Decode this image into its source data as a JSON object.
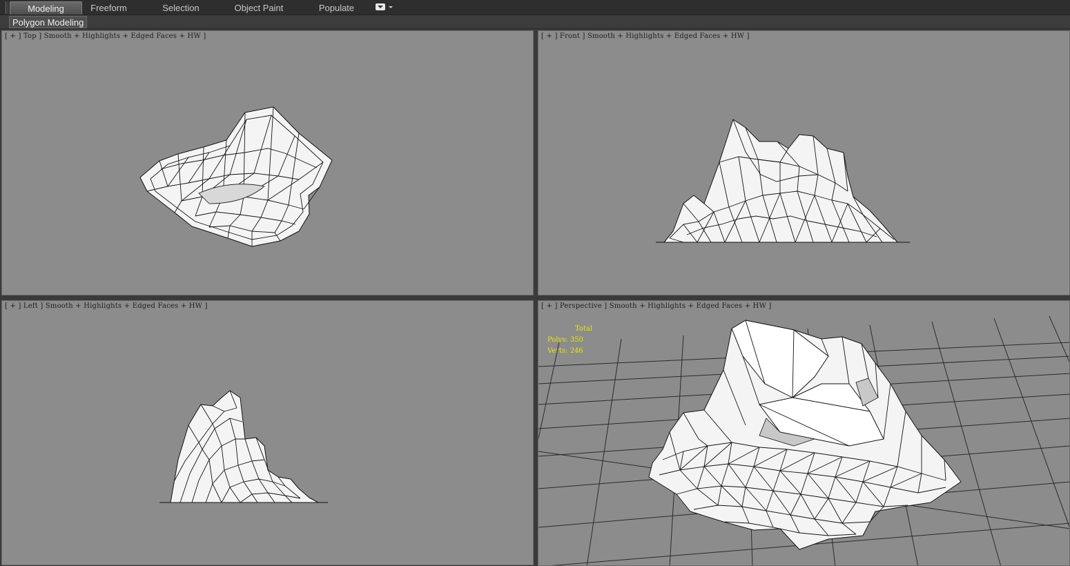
{
  "tabs": [
    {
      "label": "Modeling",
      "active": true
    },
    {
      "label": "Freeform",
      "active": false
    },
    {
      "label": "Selection",
      "active": false
    },
    {
      "label": "Object Paint",
      "active": false
    },
    {
      "label": "Populate",
      "active": false
    }
  ],
  "subtab": "Polygon Modeling",
  "viewports": {
    "top": "[ + ] Top ] Smooth + Highlights + Edged Faces + HW ]",
    "front": "[ + ] Front ] Smooth + Highlights + Edged Faces + HW ]",
    "left": "[ + ] Left ] Smooth + Highlights + Edged Faces + HW ]",
    "perspective": "[ + ] Perspective ] Smooth + Highlights + Edged Faces + HW ]"
  },
  "stats": {
    "title": "Total",
    "polys": "Polys: 350",
    "verts": "Verts: 246"
  },
  "colors": {
    "viewport_bg": "#8c8c8c",
    "mesh_fill": "#f4f4f4",
    "mesh_edge": "#111111",
    "stats_text": "#e8e800"
  }
}
